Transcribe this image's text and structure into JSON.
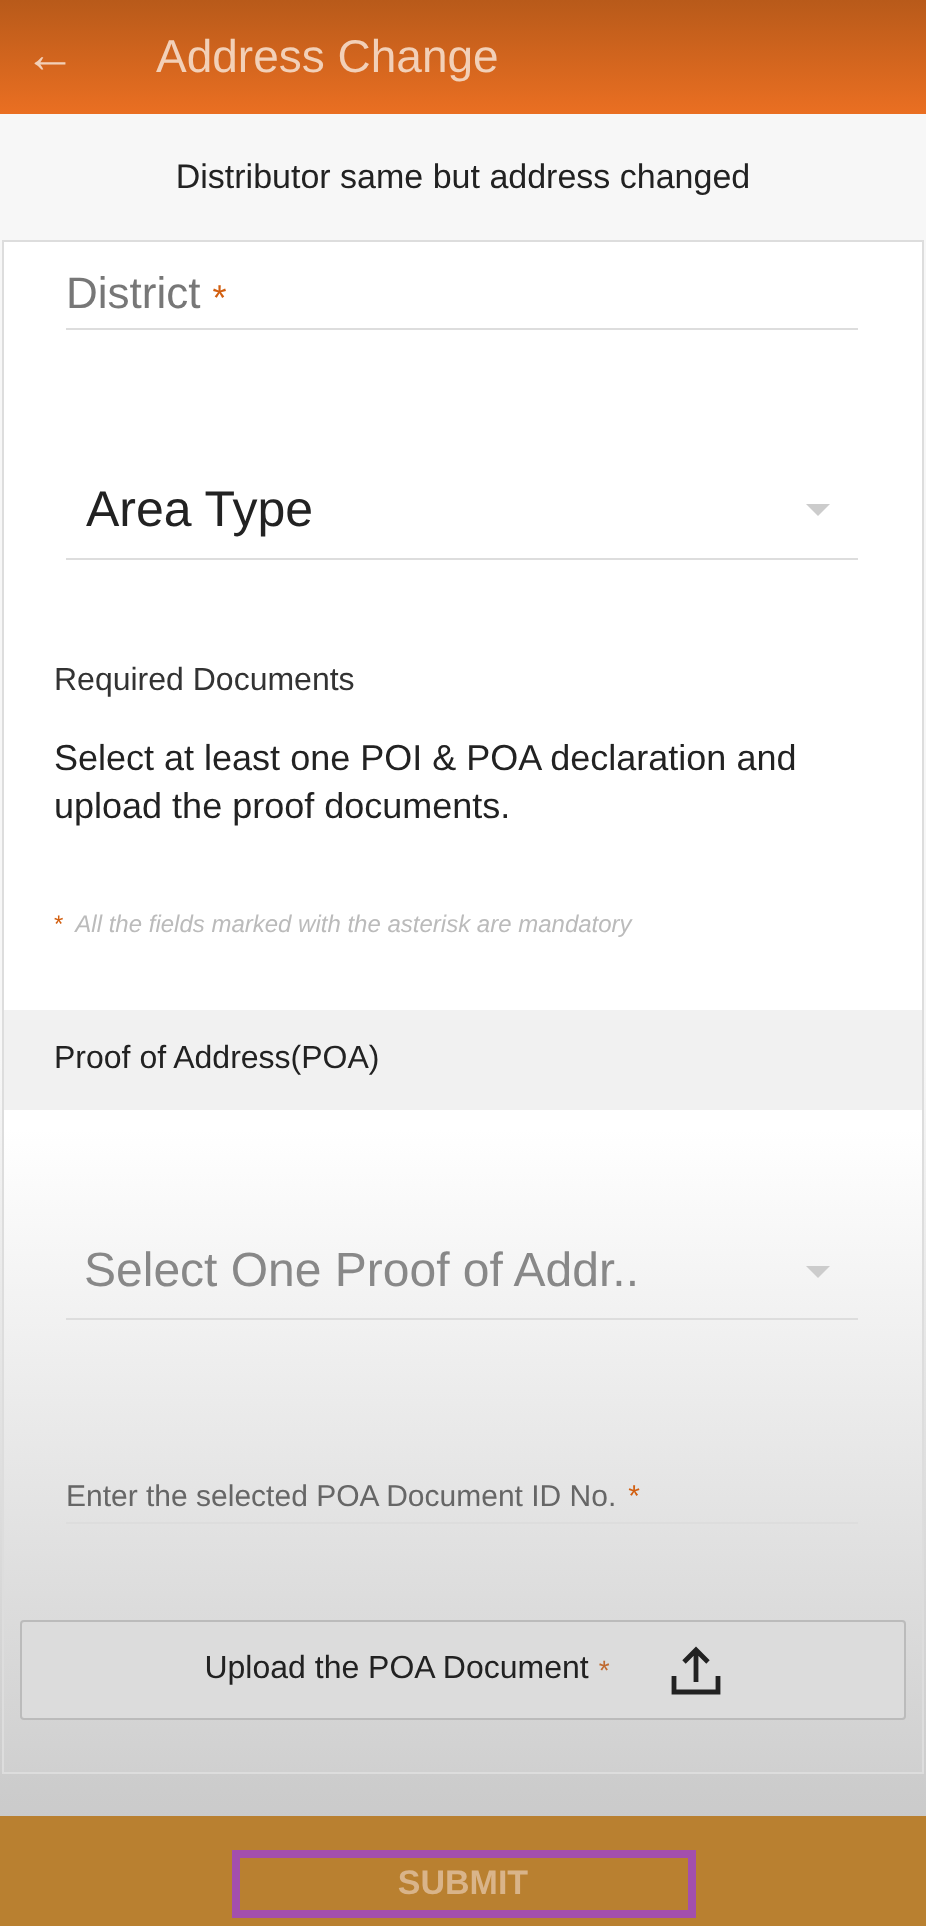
{
  "header": {
    "back_icon": "←",
    "title": "Address Change"
  },
  "subtitle": "Distributor same but address changed",
  "fields": [
    {
      "kind": "text",
      "label": "District",
      "mark": "*"
    },
    {
      "kind": "dropdown",
      "label": "Area Type"
    }
  ],
  "required_documents": {
    "heading": "Required Documents",
    "instruction": "Select at least one POI & POA declaration and upload the proof documents.",
    "note_mark": "*",
    "note": "All the fields marked with the asterisk are mandatory"
  },
  "poa": {
    "heading": "Proof of Address(POA)",
    "fields": [
      {
        "kind": "dropdown",
        "label": "Select One Proof of Addr.."
      },
      {
        "kind": "small",
        "label": "Enter the selected POA Document ID No.",
        "mark": "*"
      }
    ],
    "upload": {
      "label": "Upload the POA Document",
      "mark": "*"
    }
  },
  "submit": {
    "label": "SUBMIT",
    "highlighted": true
  }
}
